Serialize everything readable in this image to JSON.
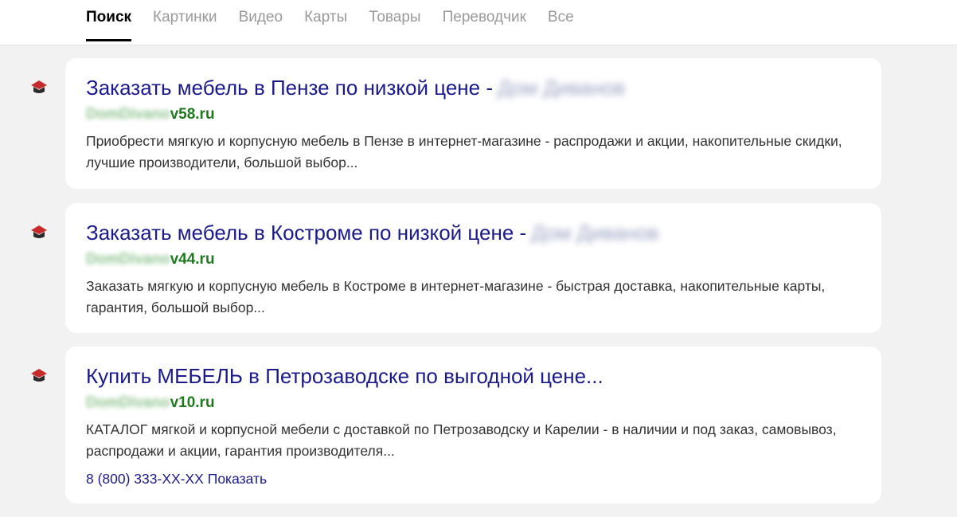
{
  "tabs": [
    {
      "label": "Поиск",
      "active": true
    },
    {
      "label": "Картинки",
      "active": false
    },
    {
      "label": "Видео",
      "active": false
    },
    {
      "label": "Карты",
      "active": false
    },
    {
      "label": "Товары",
      "active": false
    },
    {
      "label": "Переводчик",
      "active": false
    },
    {
      "label": "Все",
      "active": false
    }
  ],
  "results": [
    {
      "title": "Заказать мебель в Пензе по низкой цене -",
      "title_blurred": "Дом Диванов",
      "url_blurred": "DomDivano",
      "url_visible": "v58.ru",
      "snippet": "Приобрести мягкую и корпусную мебель в Пензе в интернет-магазине - распродажи и акции, накопительные скидки, лучшие производители, большой выбор...",
      "favicon": "sofa-icon"
    },
    {
      "title": "Заказать мебель в Костроме по низкой цене -",
      "title_blurred": "Дом Диванов",
      "url_blurred": "DomDivano",
      "url_visible": "v44.ru",
      "snippet": "Заказать мягкую и корпусную мебель в Костроме в интернет-магазине - быстрая доставка, накопительные карты, гарантия, большой выбор...",
      "favicon": "sofa-icon"
    },
    {
      "title": "Купить МЕБЕЛЬ в Петрозаводске по выгодной цене...",
      "url_blurred": "DomDivano",
      "url_visible": "v10.ru",
      "snippet": "КАТАЛОГ мягкой и корпусной мебели с доставкой по Петрозаводску и Карелии - в наличии и под заказ, самовывоз, распродажи и акции, гарантия производителя...",
      "phone": "8 (800) 333-XX-XX",
      "phone_show": "Показать",
      "favicon": "sofa-icon"
    }
  ],
  "colors": {
    "title": "#1a1a8c",
    "url": "#1f7a1f",
    "snippet": "#333333",
    "tab_inactive": "#9a9a9a",
    "favicon": "#c62a2a"
  }
}
